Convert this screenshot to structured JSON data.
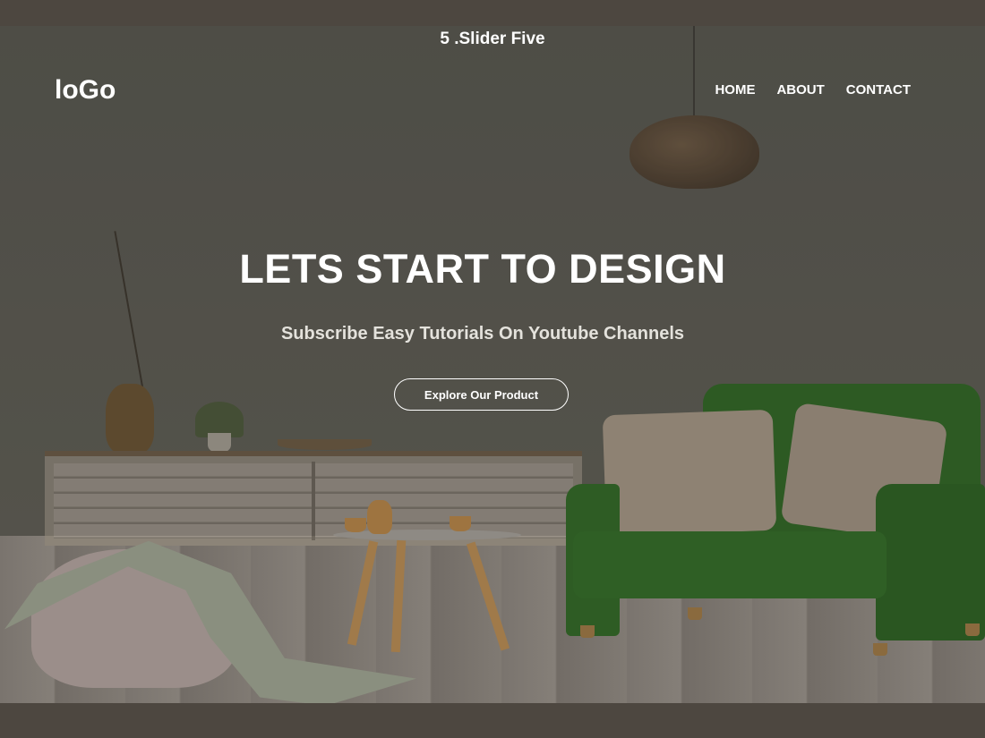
{
  "slider_label": "5 .Slider Five",
  "header": {
    "logo": "loGo",
    "nav": [
      {
        "label": "HOME"
      },
      {
        "label": "ABOUT"
      },
      {
        "label": "CONTACT"
      }
    ]
  },
  "hero": {
    "headline": "LETS START TO DESIGN",
    "subheadline": "Subscribe Easy Tutorials On Youtube Channels",
    "cta_label": "Explore Our Product"
  }
}
